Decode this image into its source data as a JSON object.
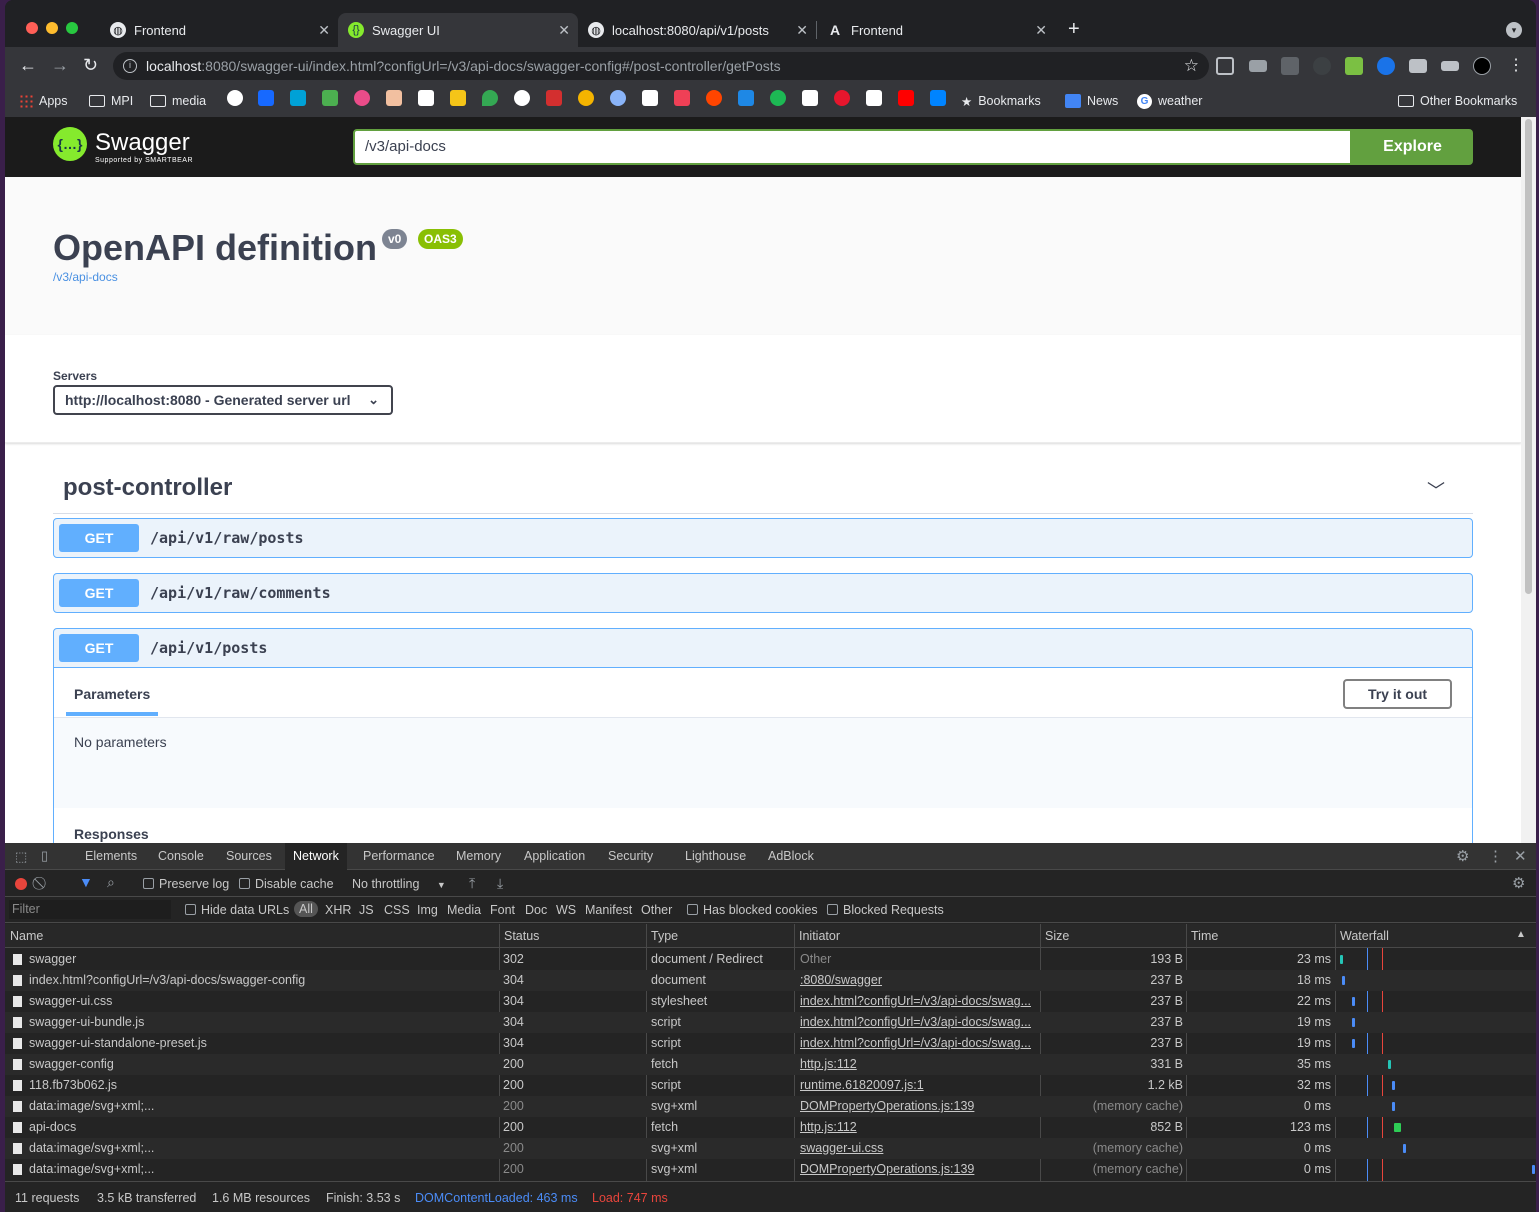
{
  "browser": {
    "tabs": [
      {
        "title": "Frontend",
        "active": false
      },
      {
        "title": "Swagger UI",
        "active": true
      },
      {
        "title": "localhost:8080/api/v1/posts",
        "active": false
      },
      {
        "title": "Frontend",
        "active": false
      }
    ],
    "url_host": "localhost",
    "url_rest": ":8080/swagger-ui/index.html?configUrl=/v3/api-docs/swagger-config#/post-controller/getPosts",
    "bookmarks": [
      {
        "label": "Apps"
      },
      {
        "label": "MPI"
      },
      {
        "label": "media"
      },
      {
        "label": "Bookmarks"
      },
      {
        "label": "News"
      },
      {
        "label": "weather"
      },
      {
        "label": "Other Bookmarks"
      }
    ]
  },
  "swagger": {
    "logo_text": "Swagger",
    "logo_sub": "Supported by SMARTBEAR",
    "spec_url": "/v3/api-docs",
    "explore_label": "Explore",
    "title": "OpenAPI definition",
    "version_badge": "v0",
    "oas_badge": "OAS3",
    "info_link": "/v3/api-docs",
    "servers_label": "Servers",
    "server_value": "http://localhost:8080 - Generated server url",
    "controller": "post-controller",
    "operations": [
      {
        "method": "GET",
        "path": "/api/v1/raw/posts"
      },
      {
        "method": "GET",
        "path": "/api/v1/raw/comments"
      },
      {
        "method": "GET",
        "path": "/api/v1/posts"
      }
    ],
    "parameters_tab": "Parameters",
    "try_it_out": "Try it out",
    "no_parameters": "No parameters",
    "responses_label": "Responses"
  },
  "devtools": {
    "tabs": [
      "Elements",
      "Console",
      "Sources",
      "Network",
      "Performance",
      "Memory",
      "Application",
      "Security",
      "Lighthouse",
      "AdBlock"
    ],
    "active_tab": "Network",
    "preserve_log": "Preserve log",
    "disable_cache": "Disable cache",
    "throttling": "No throttling",
    "filter_placeholder": "Filter",
    "hide_data_urls": "Hide data URLs",
    "type_filters": [
      "All",
      "XHR",
      "JS",
      "CSS",
      "Img",
      "Media",
      "Font",
      "Doc",
      "WS",
      "Manifest",
      "Other"
    ],
    "has_blocked_cookies": "Has blocked cookies",
    "blocked_requests": "Blocked Requests",
    "columns": [
      "Name",
      "Status",
      "Type",
      "Initiator",
      "Size",
      "Time",
      "Waterfall"
    ],
    "requests": [
      {
        "name": "swagger",
        "status": "302",
        "type": "document / Redirect",
        "initiator": "Other",
        "size": "193 B",
        "time": "23 ms",
        "wf_start": 0.0,
        "wf_color": "#25c5b6"
      },
      {
        "name": "index.html?configUrl=/v3/api-docs/swagger-config",
        "status": "304",
        "type": "document",
        "initiator": ":8080/swagger",
        "size": "237 B",
        "time": "18 ms",
        "wf_start": 0.01,
        "wf_color": "#4b8cf7"
      },
      {
        "name": "swagger-ui.css",
        "status": "304",
        "type": "stylesheet",
        "initiator": "index.html?configUrl=/v3/api-docs/swag...",
        "size": "237 B",
        "time": "22 ms",
        "wf_start": 0.06,
        "wf_color": "#4b8cf7"
      },
      {
        "name": "swagger-ui-bundle.js",
        "status": "304",
        "type": "script",
        "initiator": "index.html?configUrl=/v3/api-docs/swag...",
        "size": "237 B",
        "time": "19 ms",
        "wf_start": 0.06,
        "wf_color": "#4b8cf7"
      },
      {
        "name": "swagger-ui-standalone-preset.js",
        "status": "304",
        "type": "script",
        "initiator": "index.html?configUrl=/v3/api-docs/swag...",
        "size": "237 B",
        "time": "19 ms",
        "wf_start": 0.06,
        "wf_color": "#4b8cf7"
      },
      {
        "name": "swagger-config",
        "status": "200",
        "type": "fetch",
        "initiator": "http.js:112",
        "size": "331 B",
        "time": "35 ms",
        "wf_start": 0.25,
        "wf_color": "#25c5b6"
      },
      {
        "name": "118.fb73b062.js",
        "status": "200",
        "type": "script",
        "initiator": "runtime.61820097.js:1",
        "size": "1.2 kB",
        "time": "32 ms",
        "wf_start": 0.27,
        "wf_color": "#4b8cf7"
      },
      {
        "name": "data:image/svg+xml;...",
        "status": "200",
        "type": "svg+xml",
        "initiator": "DOMPropertyOperations.js:139",
        "size": "(memory cache)",
        "time": "0 ms",
        "wf_start": 0.27,
        "wf_color": "#4b8cf7"
      },
      {
        "name": "api-docs",
        "status": "200",
        "type": "fetch",
        "initiator": "http.js:112",
        "size": "852 B",
        "time": "123 ms",
        "wf_start": 0.28,
        "wf_color": "#2ecc55"
      },
      {
        "name": "data:image/svg+xml;...",
        "status": "200",
        "type": "svg+xml",
        "initiator": "swagger-ui.css",
        "size": "(memory cache)",
        "time": "0 ms",
        "wf_start": 0.33,
        "wf_color": "#4b8cf7"
      },
      {
        "name": "data:image/svg+xml;...",
        "status": "200",
        "type": "svg+xml",
        "initiator": "DOMPropertyOperations.js:139",
        "size": "(memory cache)",
        "time": "0 ms",
        "wf_start": 1.0,
        "wf_color": "#4b8cf7"
      }
    ],
    "summary": {
      "requests": "11 requests",
      "transferred": "3.5 kB transferred",
      "resources": "1.6 MB resources",
      "finish": "Finish: 3.53 s",
      "dcl": "DOMContentLoaded: 463 ms",
      "load": "Load: 747 ms"
    }
  }
}
